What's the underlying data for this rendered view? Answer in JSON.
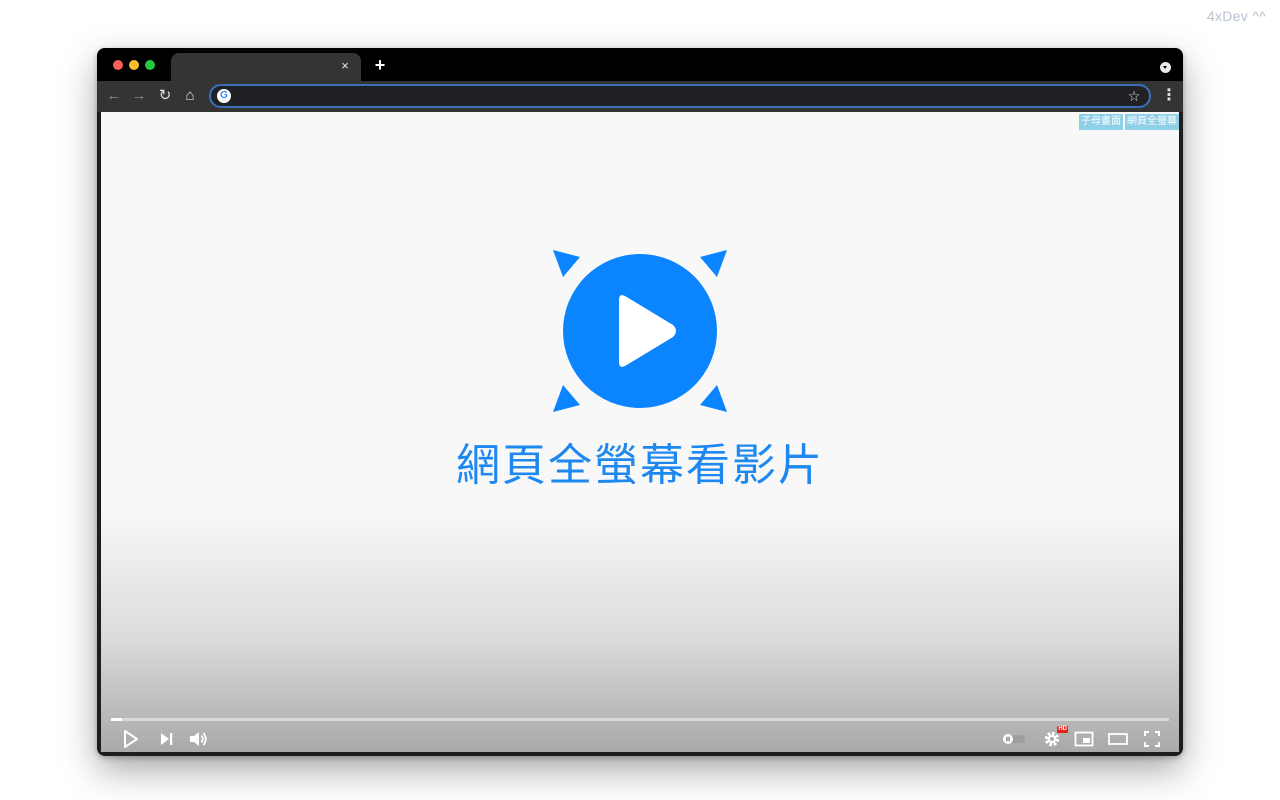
{
  "watermark": "4xDev ^^",
  "browser": {
    "tab": {
      "close_label": "×"
    },
    "new_tab_label": "+",
    "omnibox": {
      "value": ""
    },
    "toolbar": {
      "back": "←",
      "forward": "→",
      "reload": "↻",
      "home": "⌂"
    }
  },
  "page": {
    "extension_buttons": [
      "子母畫面",
      "網頁全螢幕"
    ],
    "headline": "網頁全螢幕看影片",
    "brand_color": "#1e88f0"
  },
  "player": {
    "progress": 0.01,
    "icons": [
      "play-icon",
      "next-icon",
      "volume-icon",
      "autoplay-toggle-icon",
      "settings-icon",
      "miniplayer-icon",
      "theater-mode-icon",
      "fullscreen-icon"
    ],
    "settings_badge": "HD"
  }
}
